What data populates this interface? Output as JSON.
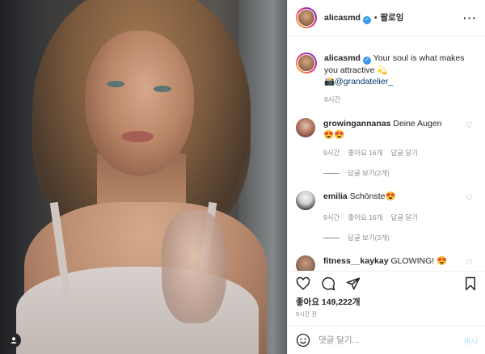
{
  "post": {
    "author": "alicasmd",
    "follow_label": "팔로잉",
    "more_label": "···",
    "caption": {
      "text": "Your soul is what makes you attractive 💫",
      "line2_emoji": "📸",
      "mention": "@grandatelier_",
      "time": "9시간"
    }
  },
  "comments": [
    {
      "user": "growingannanas",
      "text": "Deine Augen",
      "emojis": "😍😍",
      "time": "9시간",
      "likes": "좋아요 16개",
      "reply": "답글 달기",
      "view_replies": "답글 보기(2개)"
    },
    {
      "user": "emilia",
      "text": "Schönste",
      "emojis": "😍",
      "time": "9시간",
      "likes": "좋아요 16개",
      "reply": "답글 달기",
      "view_replies": "답글 보기(3개)"
    },
    {
      "user": "fitness__kaykay",
      "text": "GLOWING!",
      "emojis": "😍"
    }
  ],
  "stats": {
    "likes_text": "좋아요 149,222개",
    "posted_ago": "9시간 전"
  },
  "composer": {
    "placeholder": "댓글 달기...",
    "post_label": "게시"
  },
  "colors": {
    "link": "#00376b",
    "verified": "#3897f0",
    "muted": "#8e8e8e",
    "post_disabled": "#b2dffc"
  },
  "icons": [
    "heart-icon",
    "comment-icon",
    "share-icon",
    "bookmark-icon",
    "more-icon",
    "emoji-icon",
    "verified-icon",
    "user-tag-icon"
  ]
}
